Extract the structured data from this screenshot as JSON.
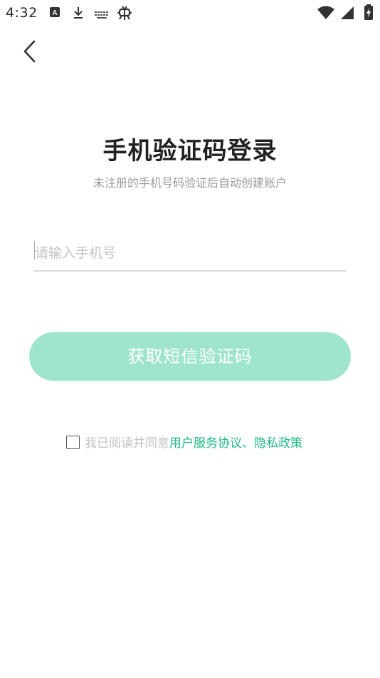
{
  "status_bar": {
    "time": "4:32",
    "icons": [
      "a-notification-icon",
      "download-icon",
      "keyboard-icon",
      "bug-icon",
      "wifi-icon",
      "cell-signal-icon",
      "battery-charging-icon"
    ]
  },
  "header": {
    "back_icon": "chevron-left-icon"
  },
  "page": {
    "title": "手机验证码登录",
    "subtitle": "未注册的手机号码验证后自动创建账户"
  },
  "form": {
    "phone_placeholder": "请输入手机号",
    "phone_value": "",
    "get_code_label": "获取短信验证码"
  },
  "agreement": {
    "checked": false,
    "prefix": "我已阅读并同意",
    "terms_link": "用户服务协议",
    "separator": "、",
    "privacy_link": "隐私政策"
  },
  "colors": {
    "accent": "#21b986",
    "button_disabled": "#9fe5ce",
    "title": "#222222",
    "subtle_text": "#999999"
  }
}
